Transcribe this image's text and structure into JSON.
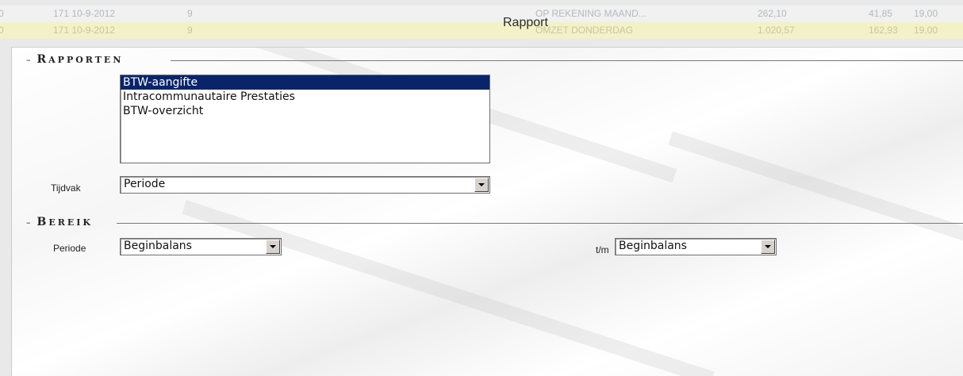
{
  "background_rows": [
    {
      "c0": "0",
      "c1": "171 10-9-2012",
      "c2": "9",
      "c3": "OP REKENING MAAND...",
      "c4": "262,10",
      "c5": "41,85",
      "c6": "19,00"
    },
    {
      "c0": "0",
      "c1": "171 10-9-2012",
      "c2": "9",
      "c3": "OMZET DONDERDAG",
      "c4": "1.020,57",
      "c5": "162,93",
      "c6": "19,00"
    }
  ],
  "dialog": {
    "title": "Rapport"
  },
  "rapporten": {
    "heading_first": "R",
    "heading_rest": "APPORTEN",
    "items": [
      "BTW-aangifte",
      "Intracommunautaire Prestaties",
      "BTW-overzicht"
    ],
    "selected_index": 0,
    "tijdvak_label": "Tijdvak",
    "tijdvak_value": "Periode"
  },
  "bereik": {
    "heading_first": "B",
    "heading_rest": "EREIK",
    "periode_label": "Periode",
    "periode_from": "Beginbalans",
    "tm_label": "t/m",
    "periode_to": "Beginbalans"
  },
  "icons": {
    "section_toggle": "minus-icon",
    "dropdown": "chevron-down-icon"
  },
  "colors": {
    "selection": "#0a246a",
    "highlight_row": "#f3f1c8"
  }
}
